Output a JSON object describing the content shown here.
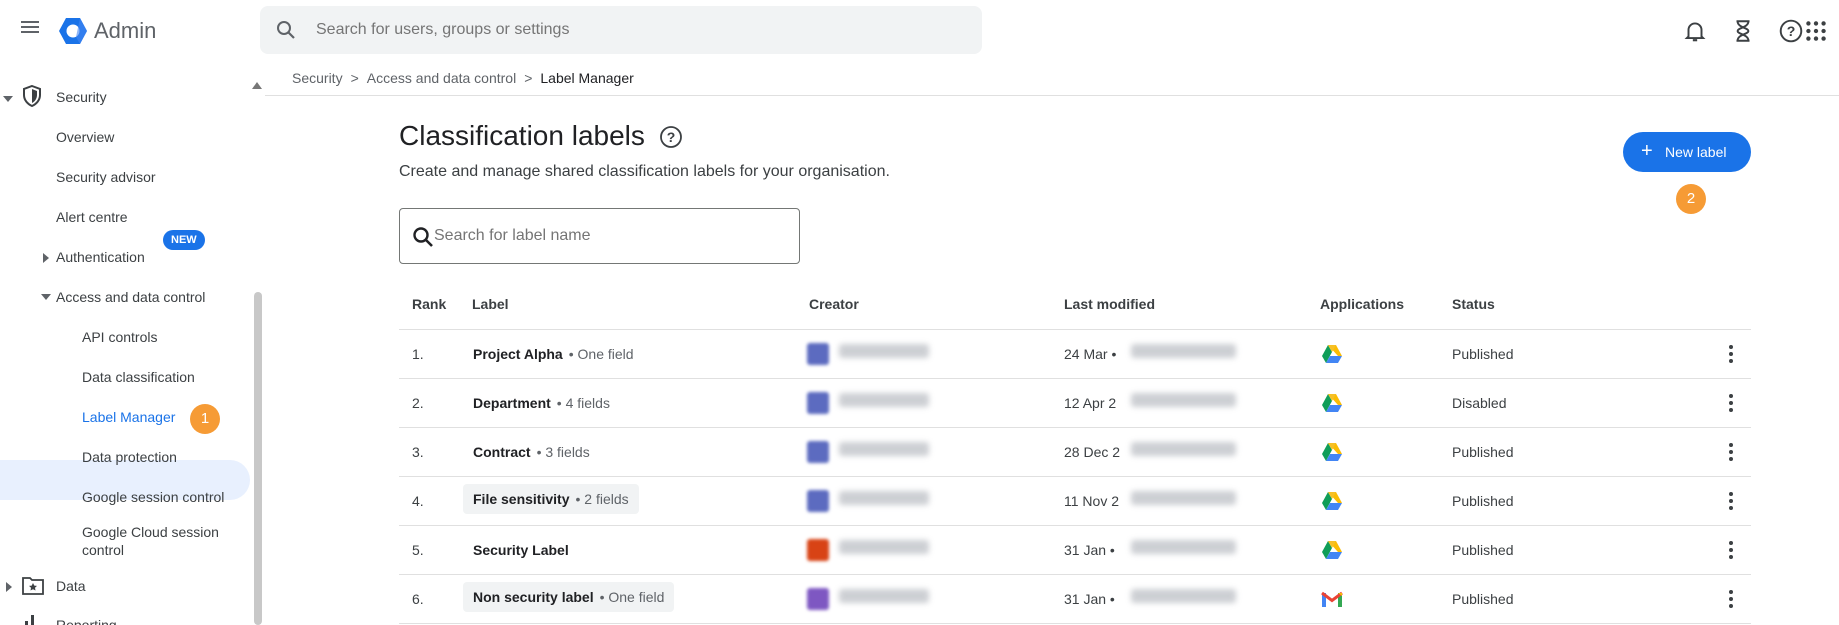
{
  "header": {
    "app_title": "Admin",
    "search_placeholder": "Search for users, groups or settings",
    "icons": [
      "menu-icon",
      "admin-logo",
      "search-icon",
      "bell-icon",
      "hourglass-icon",
      "help-icon",
      "apps-grid-icon"
    ]
  },
  "sidebar": {
    "items": [
      {
        "label": "Security",
        "icon": "shield-icon",
        "expanded": true
      },
      {
        "label": "Overview"
      },
      {
        "label": "Security advisor",
        "badge": "NEW"
      },
      {
        "label": "Alert centre"
      },
      {
        "label": "Authentication",
        "expanded": false
      },
      {
        "label": "Access and data control",
        "expanded": true
      },
      {
        "label": "API controls"
      },
      {
        "label": "Data classification"
      },
      {
        "label": "Label Manager",
        "active": true,
        "step": "1"
      },
      {
        "label": "Data protection"
      },
      {
        "label": "Google session control"
      },
      {
        "label": "Google Cloud session control"
      },
      {
        "label": "Data",
        "icon": "folder-star-icon",
        "expanded": false
      },
      {
        "label": "Reporting",
        "icon": "bar-chart-icon",
        "expanded": false
      }
    ]
  },
  "breadcrumb": {
    "items": [
      "Security",
      "Access and data control",
      "Label Manager"
    ]
  },
  "main": {
    "title": "Classification labels",
    "subtitle": "Create and manage shared classification labels for your organisation.",
    "new_label_button": "New label",
    "new_label_step": "2",
    "search_placeholder": "Search for label name"
  },
  "table": {
    "columns": [
      "Rank",
      "Label",
      "Creator",
      "Last modified",
      "Applications",
      "Status"
    ],
    "rows": [
      {
        "rank": "1.",
        "label": "Project Alpha",
        "meta": "• One field",
        "chip": false,
        "modified_date": "24 Mar •",
        "application": "google-drive-icon",
        "status": "Published",
        "avatar_color": "#5c6bc0"
      },
      {
        "rank": "2.",
        "label": "Department",
        "meta": "• 4 fields",
        "chip": false,
        "modified_date": "12 Apr 2",
        "application": "google-drive-icon",
        "status": "Disabled",
        "avatar_color": "#5c6bc0"
      },
      {
        "rank": "3.",
        "label": "Contract",
        "meta": "• 3 fields",
        "chip": false,
        "modified_date": "28 Dec 2",
        "application": "google-drive-icon",
        "status": "Published",
        "avatar_color": "#5c6bc0"
      },
      {
        "rank": "4.",
        "label": "File sensitivity",
        "meta": "• 2 fields",
        "chip": true,
        "modified_date": "11 Nov 2",
        "application": "google-drive-icon",
        "status": "Published",
        "avatar_color": "#5c6bc0"
      },
      {
        "rank": "5.",
        "label": "Security Label",
        "meta": "",
        "chip": false,
        "modified_date": "31 Jan •",
        "application": "google-drive-icon",
        "status": "Published",
        "avatar_color": "#d84315"
      },
      {
        "rank": "6.",
        "label": "Non security label",
        "meta": "• One field",
        "chip": true,
        "modified_date": "31 Jan •",
        "application": "gmail-icon",
        "status": "Published",
        "avatar_color": "#7e57c2"
      }
    ]
  },
  "colors": {
    "accent": "#1a73e8",
    "step_badge": "#f69b35",
    "active_nav_bg": "#e8f0fe"
  }
}
